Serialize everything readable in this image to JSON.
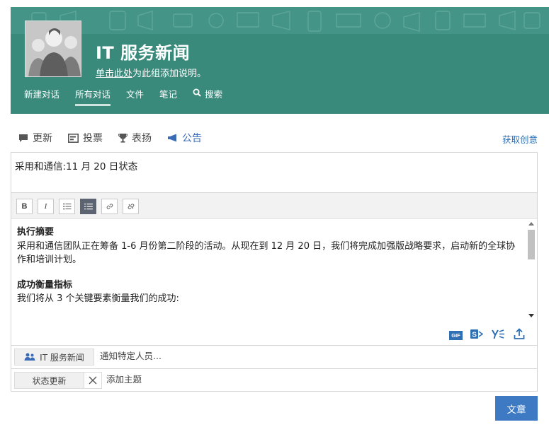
{
  "group": {
    "name": "IT 服务新闻",
    "desc_link": "单击此处",
    "desc_rest": "为此组添加说明。",
    "avatar_icon": "group-people-icon"
  },
  "nav": [
    {
      "label": "新建对话",
      "active": false
    },
    {
      "label": "所有对话",
      "active": true
    },
    {
      "label": "文件",
      "active": false
    },
    {
      "label": "笔记",
      "active": false
    },
    {
      "label": "搜索",
      "active": false,
      "icon": "search-icon"
    }
  ],
  "publisher": {
    "tabs": [
      {
        "label": "更新",
        "icon": "chat-bubble-icon",
        "active": false
      },
      {
        "label": "投票",
        "icon": "poll-icon",
        "active": false
      },
      {
        "label": "表扬",
        "icon": "trophy-icon",
        "active": false
      },
      {
        "label": "公告",
        "icon": "megaphone-icon",
        "active": true
      }
    ],
    "get_ideas": "获取创意"
  },
  "composer": {
    "subject": "采用和通信:11 月 20 日状态",
    "toolbar": [
      "bold-icon",
      "italic-icon",
      "bullet-list-icon",
      "numbered-list-icon",
      "link-icon",
      "unlink-icon"
    ],
    "toolbar_bold": "B",
    "toolbar_italic": "I",
    "body": {
      "h1": "执行摘要",
      "p1": "采用和通信团队正在筹备 1-6 月份第二阶段的活动。从现在到 12 月 20 日，我们将完成加强版战略要求，启动新的全球协作和培训计划。",
      "h2": "成功衡量指标",
      "p2": "我们将从 3 个关键要素衡量我们的成功:"
    },
    "attach_icons": [
      "gif-icon",
      "sharepoint-icon",
      "yammer-icon",
      "upload-icon"
    ],
    "gif_label": "GIF",
    "notify_group": "IT 服务新闻",
    "notify_placeholder": "通知特定人员...",
    "topic_chip": "状态更新",
    "topic_placeholder": "添加主题"
  },
  "post_button": "文章",
  "colors": {
    "banner": "#3a8a7c",
    "accent": "#3d7ac3",
    "active_tab": "#3a6bb7"
  }
}
